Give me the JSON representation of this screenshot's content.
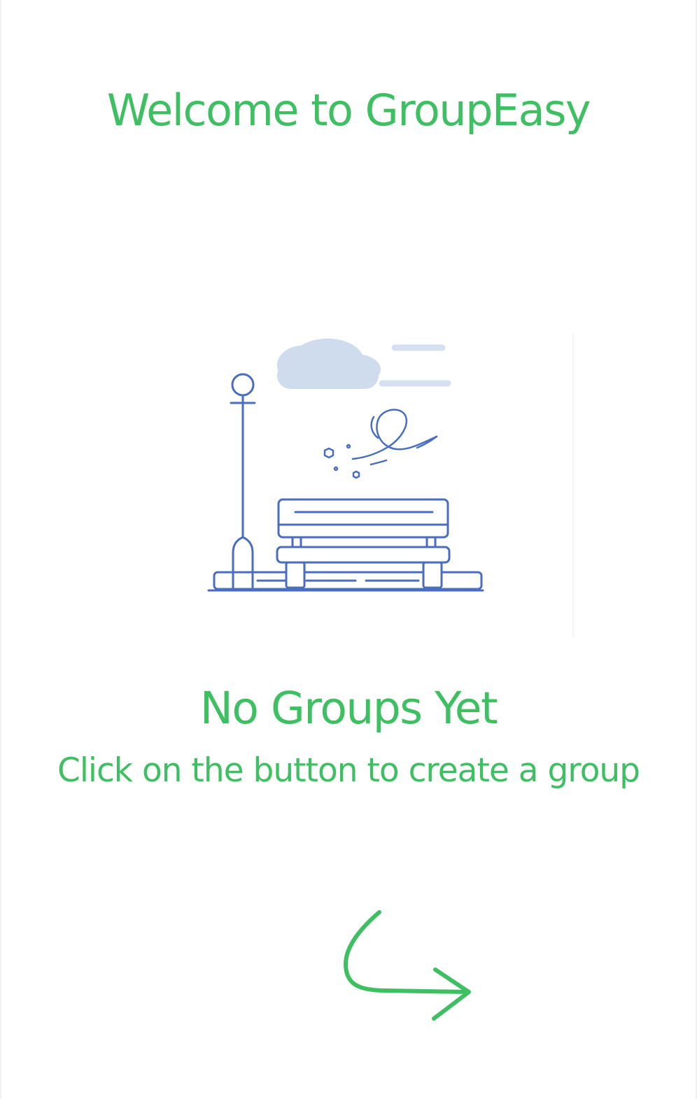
{
  "app": {
    "welcome_title": "Welcome to GroupEasy"
  },
  "colors": {
    "accent_green": "#3dbf62",
    "illustration_blue": "#4a6dbf",
    "cloud_blue": "#c7d6ec",
    "background": "#ffffff"
  },
  "empty_state": {
    "illustration": "park-bench-icon",
    "title": "No Groups Yet",
    "subtitle": "Click on the button to create a group",
    "hint_icon": "curved-arrow-icon"
  }
}
